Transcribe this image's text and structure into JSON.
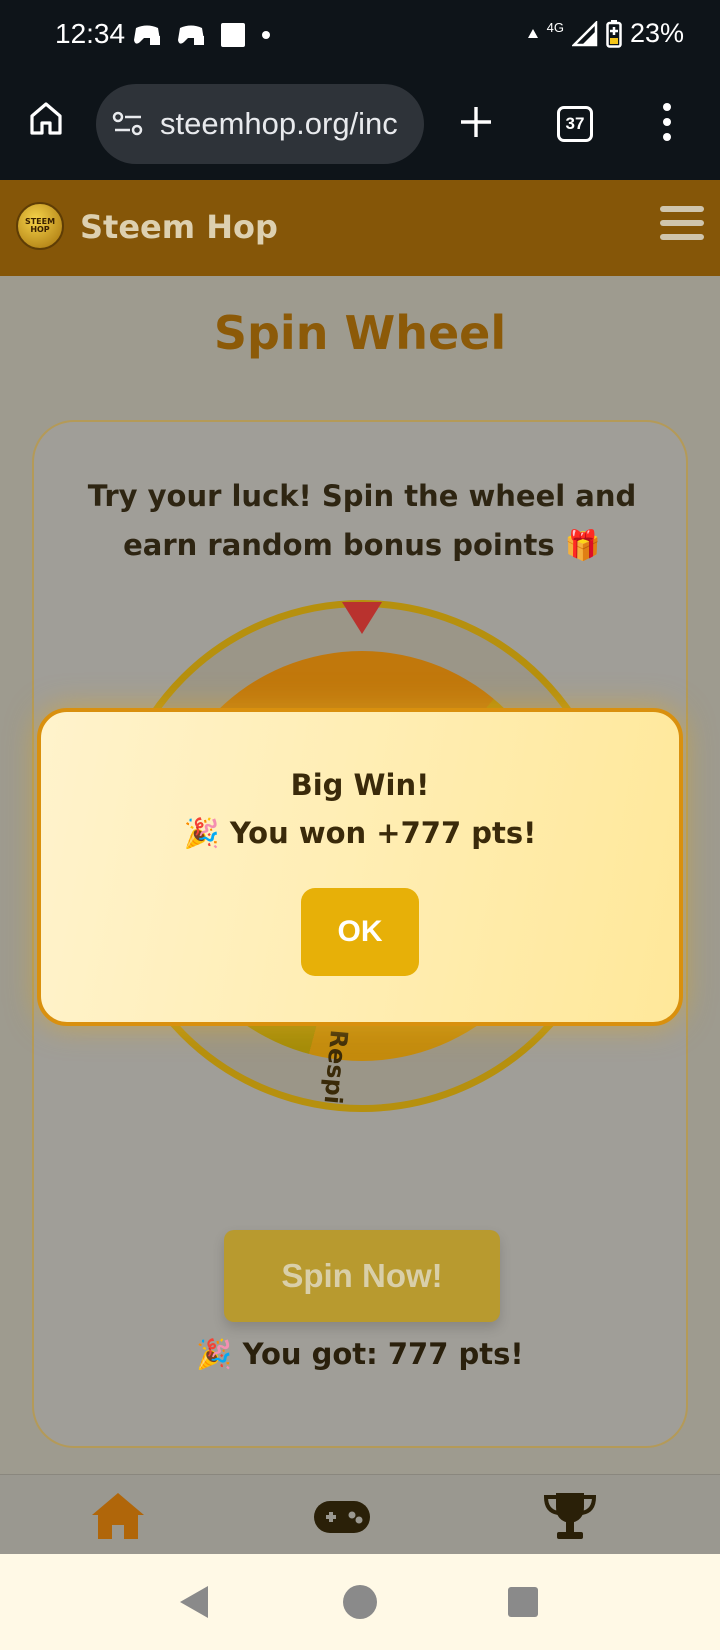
{
  "status_bar": {
    "time": "12:34",
    "network": "4G",
    "battery": "23%"
  },
  "browser": {
    "url": "steemhop.org/inc",
    "tab_count": "37"
  },
  "app": {
    "brand": "Steem Hop",
    "logo_text": "STEEM HOP"
  },
  "page": {
    "title": "Spin Wheel",
    "intro": "Try your luck! Spin the wheel and earn random bonus points 🎁",
    "wheel_labels": [
      "Respin"
    ],
    "spin_button": "Spin Now!",
    "result": "🎉 You got: 777 pts!"
  },
  "modal": {
    "title": "Big Win!",
    "message": "🎉 You won +777 pts!",
    "ok_label": "OK"
  },
  "colors": {
    "header_bg": "#855608",
    "accent": "#e7b008",
    "title": "#8c5a08"
  }
}
